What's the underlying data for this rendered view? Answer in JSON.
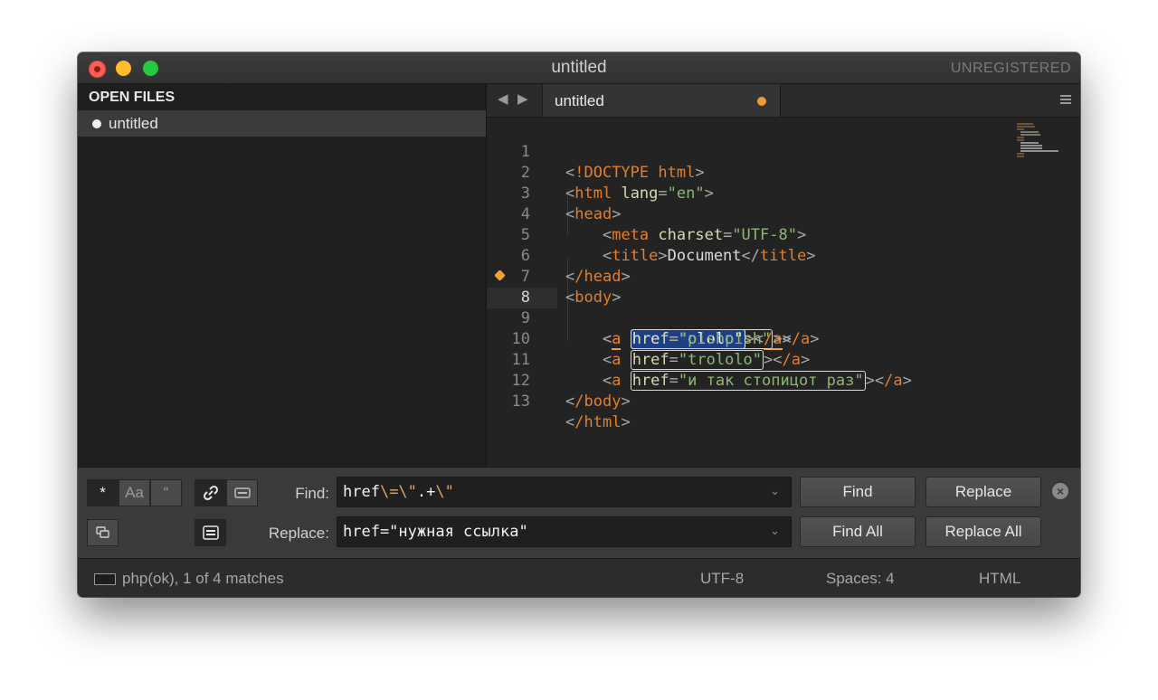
{
  "window": {
    "title": "untitled",
    "unregistered": "UNREGISTERED"
  },
  "sidebar": {
    "header": "OPEN FILES",
    "files": [
      {
        "name": "untitled"
      }
    ]
  },
  "tabs": [
    {
      "label": "untitled",
      "modified": true
    }
  ],
  "editor": {
    "current_line": 8,
    "lines": [
      {
        "n": "1"
      },
      {
        "n": "2"
      },
      {
        "n": "3"
      },
      {
        "n": "4"
      },
      {
        "n": "5"
      },
      {
        "n": "6"
      },
      {
        "n": "7"
      },
      {
        "n": "8"
      },
      {
        "n": "9"
      },
      {
        "n": "10"
      },
      {
        "n": "11"
      },
      {
        "n": "12"
      },
      {
        "n": "13"
      }
    ],
    "code": {
      "l1_tag": "!DOCTYPE html",
      "l2_tag": "html",
      "l2_attr": "lang",
      "l2_val": "\"en\"",
      "l3_tag": "head",
      "l4_tag": "meta",
      "l4_attr": "charset",
      "l4_val": "\"UTF-8\"",
      "l5_tag": "title",
      "l5_text": "Document",
      "l6_tag": "/head",
      "l7_tag": "body",
      "l8_tag": "a",
      "l8_attr": "href=",
      "l8_val": "\"ololo\"",
      "l9_tag": "a",
      "l9_attr": "href",
      "l9_val": "\"pishpish\"",
      "l10_tag": "a",
      "l10_attr": "href",
      "l10_val": "\"trololo\"",
      "l11_tag": "a",
      "l11_attr": "href",
      "l11_val": "\"и так стопицот раз\"",
      "l12_tag": "/body",
      "l13_tag": "/html",
      "close_a": "/a"
    }
  },
  "find_panel": {
    "options": {
      "regex": "*",
      "case": "Aa",
      "whole_word": "“",
      "wrap_icon": "link-icon",
      "in_selection_icon": "selection-icon",
      "preserve_case_icon": "preserve-case-icon",
      "highlight_icon": "highlight-icon"
    },
    "find_label": "Find:",
    "find_value_parts": [
      "href",
      "\\=\\\"",
      ".+",
      "\\\""
    ],
    "replace_label": "Replace:",
    "replace_value": "href=\"нужная ссылка\"",
    "buttons": {
      "find": "Find",
      "replace": "Replace",
      "find_all": "Find All",
      "replace_all": "Replace All"
    },
    "close_glyph": "×"
  },
  "statusbar": {
    "message": "php(ok), 1 of 4 matches",
    "encoding": "UTF-8",
    "indent": "Spaces: 4",
    "syntax": "HTML"
  },
  "colors": {
    "tag": "#e47f2b",
    "string": "#8fb773",
    "attribute": "#d8d8b0",
    "selection": "#1d3f87",
    "modified_dot": "#f29a3b"
  }
}
